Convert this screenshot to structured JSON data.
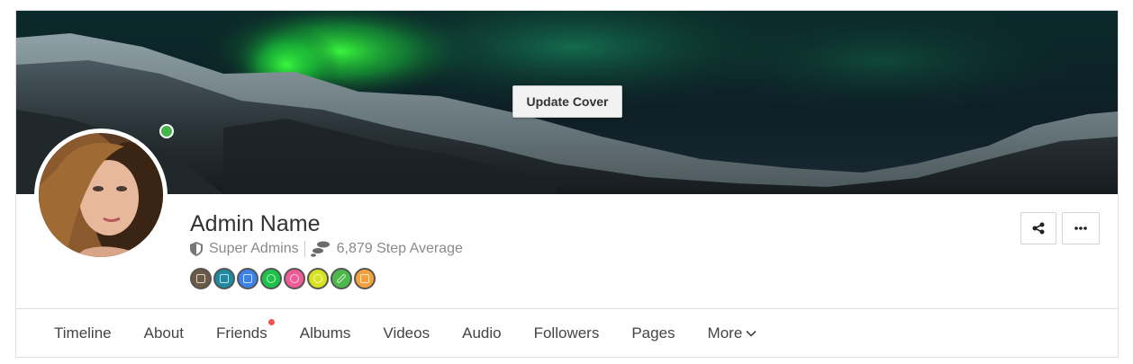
{
  "cover": {
    "update_label": "Update Cover"
  },
  "profile": {
    "name": "Admin Name",
    "role": "Super Admins",
    "steps": "6,879 Step Average",
    "online": true,
    "status_color": "#42b54b"
  },
  "badges": [
    {
      "name": "badge-calendar-icon",
      "color": "#6b5a45"
    },
    {
      "name": "badge-network-icon",
      "color": "#1d8aa1"
    },
    {
      "name": "badge-document-icon",
      "color": "#3b82e8"
    },
    {
      "name": "badge-chat-icon",
      "color": "#1cc24a"
    },
    {
      "name": "badge-eye-icon",
      "color": "#ef5a97"
    },
    {
      "name": "badge-gear-icon",
      "color": "#d8e21e"
    },
    {
      "name": "badge-pencil-icon",
      "color": "#4cb84c"
    },
    {
      "name": "badge-trophy-icon",
      "color": "#f6a23c"
    }
  ],
  "actions": {
    "share_icon": "share-icon",
    "more_icon": "ellipsis-icon"
  },
  "nav": {
    "items": [
      {
        "label": "Timeline"
      },
      {
        "label": "About"
      },
      {
        "label": "Friends",
        "notification": true
      },
      {
        "label": "Albums"
      },
      {
        "label": "Videos"
      },
      {
        "label": "Audio"
      },
      {
        "label": "Followers"
      },
      {
        "label": "Pages"
      },
      {
        "label": "More"
      }
    ],
    "notification_color": "#f0534e"
  }
}
